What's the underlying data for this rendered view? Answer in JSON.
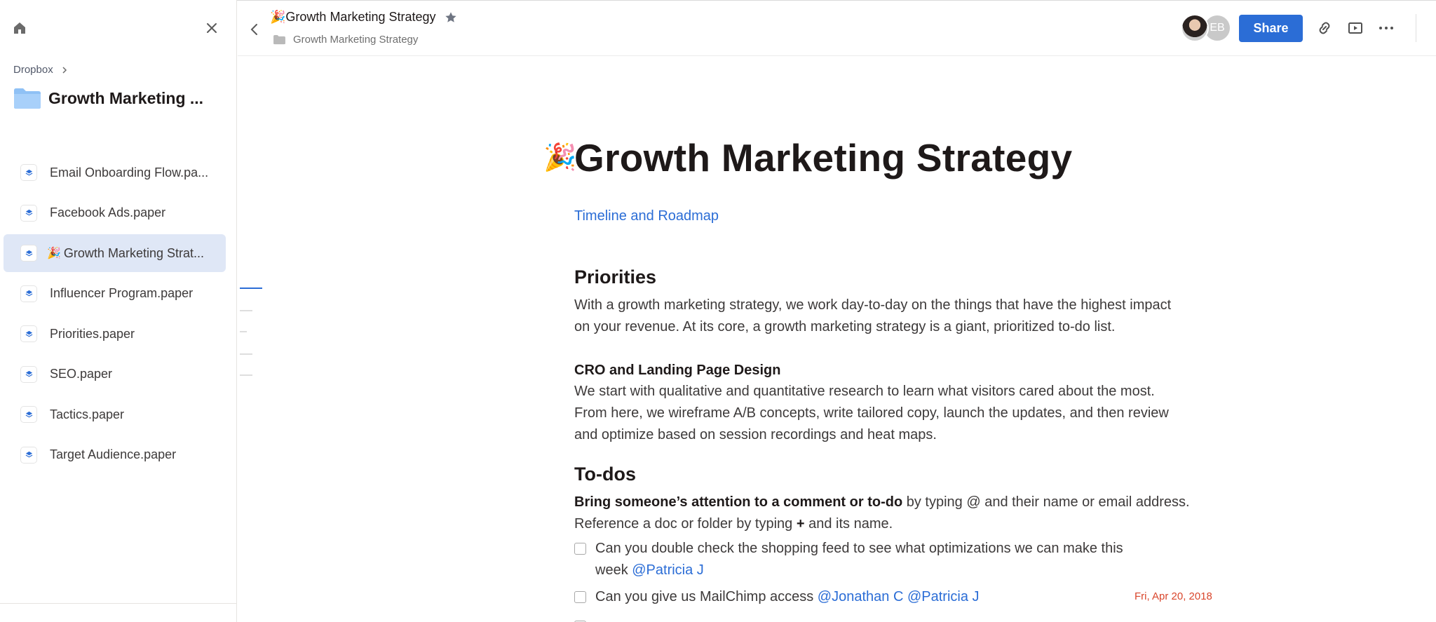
{
  "sidebar": {
    "breadcrumb": "Dropbox",
    "folder_title": "Growth Marketing ...",
    "items": [
      {
        "label": "Email Onboarding Flow.pa...",
        "emoji": ""
      },
      {
        "label": "Facebook Ads.paper",
        "emoji": ""
      },
      {
        "label": "Growth Marketing Strat...",
        "emoji": "🎉"
      },
      {
        "label": "Influencer Program.paper",
        "emoji": ""
      },
      {
        "label": "Priorities.paper",
        "emoji": ""
      },
      {
        "label": "SEO.paper",
        "emoji": ""
      },
      {
        "label": "Tactics.paper",
        "emoji": ""
      },
      {
        "label": "Target Audience.paper",
        "emoji": ""
      }
    ],
    "active_index": 2
  },
  "header": {
    "title_emoji": "🎉",
    "title": "Growth Marketing Strategy",
    "path": "Growth Marketing Strategy",
    "avatar_initials": "EB",
    "share_label": "Share"
  },
  "doc": {
    "title_emoji": "🎉",
    "title": "Growth Marketing Strategy",
    "link": "Timeline and Roadmap",
    "priorities_heading": "Priorities",
    "priorities_line1": "With a growth marketing strategy, we work day-to-day on the things that have the highest impact",
    "priorities_line2": "on your revenue. At its core, a growth marketing strategy is a giant, prioritized to-do list.",
    "cro_heading": "CRO and Landing Page Design",
    "cro_line1": "We start with qualitative and quantitative research to learn what visitors cared about the most.",
    "cro_line2": "From here, we wireframe A/B concepts, write tailored copy, launch the updates, and then review",
    "cro_line3": "and optimize based on session recordings and heat maps.",
    "todos_heading": "To-dos",
    "todos_bold": "Bring someone’s attention to a comment or to-do",
    "todos_rest": " by typing @ and their name or email address.",
    "todos_line2a": "Reference a doc or folder by typing ",
    "todos_plus": "+",
    "todos_line2b": " and its name.",
    "todo1_line1": "Can you double check the shopping feed to see what optimizations we can make this",
    "todo1_line2": "week ",
    "todo1_mention": "@Patricia J",
    "todo2_text": "Can you give us MailChimp access ",
    "todo2_mention1": "@Jonathan C",
    "todo2_mention2": "@Patricia J",
    "todo2_due": "Fri, Apr 20, 2018"
  },
  "colors": {
    "accent": "#2b6dd6",
    "active_bg": "#dfe7f6",
    "due_date": "#d9462c"
  }
}
